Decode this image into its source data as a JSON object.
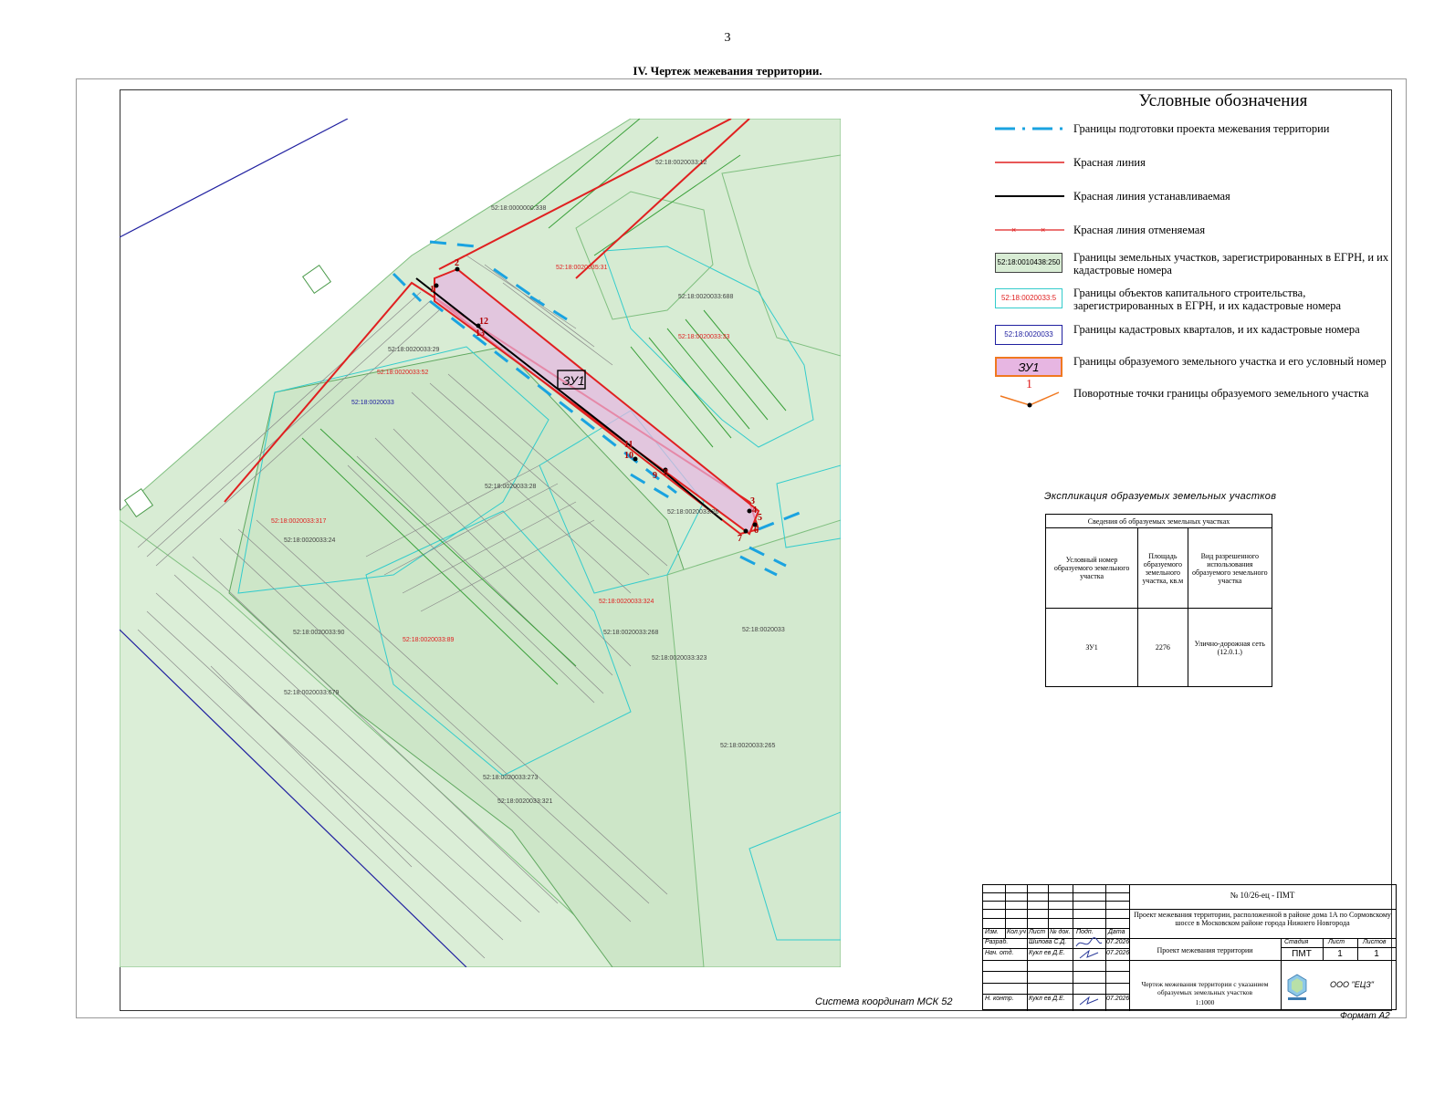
{
  "page": {
    "number": "3",
    "heading": "IV.  Чертеж межевания территории."
  },
  "legend": {
    "title": "Условные обозначения",
    "items": [
      {
        "symbol": "blue-dash-dot-line",
        "color": "#1aa3e0",
        "text": "Границы подготовки проекта межевания территории"
      },
      {
        "symbol": "red-line",
        "color": "#e02020",
        "text": "Красная линия"
      },
      {
        "symbol": "black-line",
        "color": "#000000",
        "text": "Красная линия устанавливаемая"
      },
      {
        "symbol": "red-cross-line",
        "color": "#e02020",
        "text": "Красная линия отменяемая"
      },
      {
        "symbol": "green-box",
        "color": "#7fbf7f",
        "box_text": "52:18:0010438:250",
        "text": "Границы земельных участков, зарегистрированных в ЕГРН, и их кадастровые номера"
      },
      {
        "symbol": "cyan-box",
        "color": "#33cccc",
        "box_text": "52:18:0020033:5",
        "text": "Границы объектов капитального строительства, зарегистрированных в ЕГРН, и их кадастровые номера"
      },
      {
        "symbol": "blue-box",
        "color": "#2020a0",
        "box_text": "52:18:0020033",
        "text": "Границы кадастровых кварталов, и их кадастровые номера"
      },
      {
        "symbol": "orange-box",
        "color": "#f07820",
        "box_text": "ЗУ1",
        "text": "Границы образуемого земельного участка и его условный номер"
      },
      {
        "symbol": "turn-point",
        "color": "#f07820",
        "box_text": "1",
        "text": "Поворотные точки границы образуемого земельного участка"
      }
    ]
  },
  "explication": {
    "title": "Экспликация образуемых земельных участков",
    "table_header": "Сведения об образуемых земельных участках",
    "columns": [
      "Условный номер образуемого земельного участка",
      "Площадь образуемого земельного участка, кв.м",
      "Вид разрешенного использования образуемого земельного участка"
    ],
    "rows": [
      {
        "number": "ЗУ1",
        "area": "2276",
        "use": "Улично-дорожная сеть (12.0.1.)"
      }
    ]
  },
  "map": {
    "coord_system": "Система координат МСК 52",
    "plot_label": "ЗУ1",
    "labels": [
      {
        "text": "52:18:0020033:12",
        "kind": "parcel"
      },
      {
        "text": "52:18:0000000:338",
        "kind": "parcel"
      },
      {
        "text": "52:18:0020035:31",
        "kind": "building"
      },
      {
        "text": "52:18:0020033:688",
        "kind": "parcel"
      },
      {
        "text": "52:18:0020033:33",
        "kind": "building"
      },
      {
        "text": "52:18:0020033:29",
        "kind": "parcel"
      },
      {
        "text": "52:18:0020033:52",
        "kind": "building"
      },
      {
        "text": "52:18:0020033",
        "kind": "quarter"
      },
      {
        "text": "52:18:0020033:28",
        "kind": "parcel"
      },
      {
        "text": "52:18:0020033:317",
        "kind": "building"
      },
      {
        "text": "52:18:0020033:24",
        "kind": "parcel"
      },
      {
        "text": "52:18:0020033:324",
        "kind": "building"
      },
      {
        "text": "52:18:0020033:268",
        "kind": "parcel"
      },
      {
        "text": "52:18:0020033:323",
        "kind": "parcel"
      },
      {
        "text": "52:18:0020033",
        "kind": "parcel"
      },
      {
        "text": "52:18:0020033:90",
        "kind": "parcel"
      },
      {
        "text": "52:18:0020033:89",
        "kind": "building"
      },
      {
        "text": "52:18:0020033:679",
        "kind": "parcel"
      },
      {
        "text": "52:18:0020033:265",
        "kind": "parcel"
      },
      {
        "text": "52:18:0020033:273",
        "kind": "parcel"
      },
      {
        "text": "52:18:0020033:321",
        "kind": "parcel"
      },
      {
        "text": "52:18:0020033:26",
        "kind": "parcel"
      }
    ],
    "points": [
      "1",
      "2",
      "3",
      "4",
      "5",
      "6",
      "7",
      "8",
      "9",
      "10",
      "11",
      "12",
      "13"
    ]
  },
  "title_block": {
    "doc_number": "№ 10/26-ец - ПМТ",
    "project_title": "Проект  межевания территории, расположенной в районе дома 1А по Сормовскому шоссе в Московском районе города Нижнего Новгорода",
    "headers": [
      "Изм.",
      "Кол.уч",
      "Лист",
      "№ док.",
      "Подп.",
      "Дата"
    ],
    "roles": [
      {
        "role": "Разраб.",
        "name": "Шипова С.Д.",
        "date": "07.2026"
      },
      {
        "role": "Нач. отд.",
        "name": "Кукл ев Д.Е.",
        "date": "07.2026"
      },
      {
        "role": "Н. контр.",
        "name": "Кукл ев Д.Е.",
        "date": "07.2026"
      }
    ],
    "stage_title": "Проект  межевания территории",
    "stage_header": "Стадия",
    "sheet_header": "Лист",
    "sheets_header": "Листов",
    "stage": "ПМТ",
    "sheet": "1",
    "sheets": "1",
    "drawing_title": "Чертеж  межевания территории с указанием образуемых земельных участков",
    "scale": "1:1000",
    "company": "ООО \"ЕЦЗ\"",
    "format": "Формат А2"
  }
}
